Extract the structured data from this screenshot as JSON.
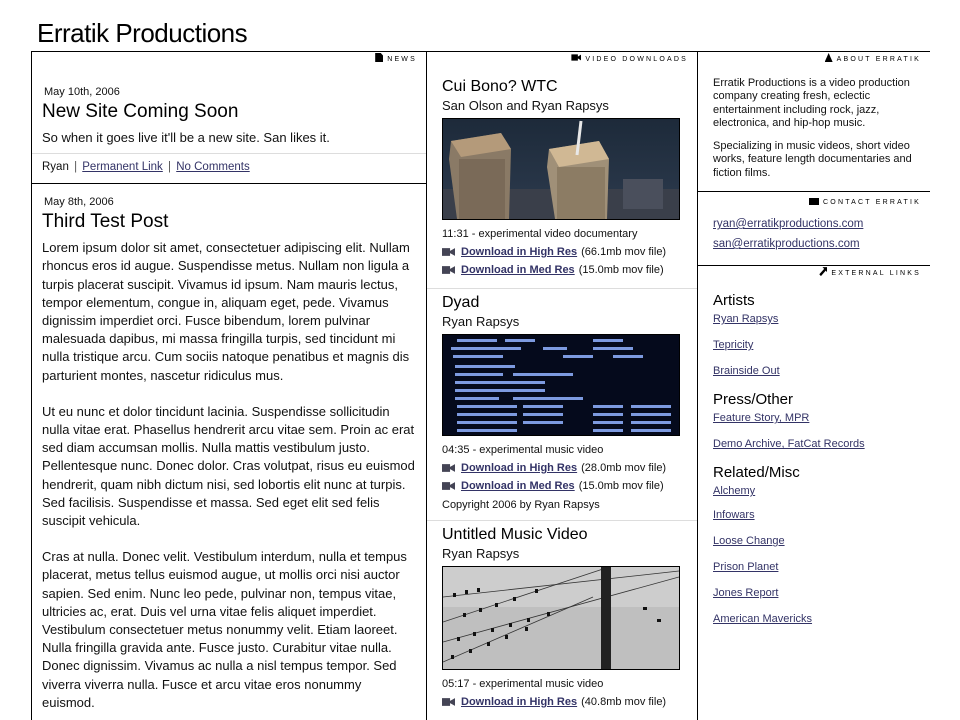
{
  "site": {
    "title": "Erratik Productions"
  },
  "news": {
    "heading": "News",
    "posts": [
      {
        "date": "May 10th, 2006",
        "title": "New Site Coming Soon",
        "body": [
          "So when it goes live it'll be a new site. San likes it."
        ],
        "author": "Ryan",
        "permalink_label": "Permanent Link",
        "comments_label": "No Comments",
        "separator": "|"
      },
      {
        "date": "May 8th, 2006",
        "title": "Third Test Post",
        "body": [
          "Lorem ipsum dolor sit amet, consectetuer adipiscing elit. Nullam rhoncus eros id augue. Suspendisse metus. Nullam non ligula a turpis placerat suscipit. Vivamus id ipsum. Nam mauris lectus, tempor elementum, congue in, aliquam eget, pede. Vivamus dignissim imperdiet orci. Fusce bibendum, lorem pulvinar malesuada dapibus, mi massa fringilla turpis, sed tincidunt mi nulla tristique arcu. Cum sociis natoque penatibus et magnis dis parturient montes, nascetur ridiculus mus.",
          "Ut eu nunc et dolor tincidunt lacinia. Suspendisse sollicitudin nulla vitae erat. Phasellus hendrerit arcu vitae sem. Proin ac erat sed diam accumsan mollis. Nulla mattis vestibulum justo. Pellentesque nunc. Donec dolor. Cras volutpat, risus eu euismod hendrerit, quam nibh dictum nisi, sed lobortis elit nunc at turpis. Sed facilisis. Suspendisse et massa. Sed eget elit sed felis suscipit vehicula.",
          "Cras at nulla. Donec velit. Vestibulum interdum, nulla et tempus placerat, metus tellus euismod augue, ut mollis orci nisi auctor sapien. Sed enim. Nunc leo pede, pulvinar non, tempus vitae, ultricies ac, erat. Duis vel urna vitae felis aliquet imperdiet. Vestibulum consectetuer metus nonummy velit. Etiam laoreet. Nulla fringilla gravida ante. Fusce justo. Curabitur vitae nulla. Donec dignissim. Vivamus ac nulla a nisl tempus tempor. Sed viverra viverra nulla. Fusce et arcu vitae eros nonummy euismod."
        ]
      }
    ]
  },
  "videos": {
    "heading": "Video Downloads",
    "items": [
      {
        "title": "Cui Bono? WTC",
        "artist": "San Olson and Ryan Rapsys",
        "thumb": "wtc-aerial",
        "desc": "11:31 - experimental video documentary",
        "downloads": [
          {
            "label": "Download in High Res",
            "size": "(66.1mb mov file)"
          },
          {
            "label": "Download in Med Res",
            "size": "(15.0mb mov file)"
          }
        ]
      },
      {
        "title": "Dyad",
        "artist": "Ryan Rapsys",
        "thumb": "terminal-screen",
        "desc": "04:35 - experimental music video",
        "downloads": [
          {
            "label": "Download in High Res",
            "size": "(28.0mb mov file)"
          },
          {
            "label": "Download in Med Res",
            "size": "(15.0mb mov file)"
          }
        ],
        "copyright": "Copyright 2006 by Ryan Rapsys"
      },
      {
        "title": "Untitled Music Video",
        "artist": "Ryan Rapsys",
        "thumb": "birds-wires",
        "desc": "05:17 - experimental music video",
        "downloads": [
          {
            "label": "Download in High Res",
            "size": "(40.8mb mov file)"
          }
        ]
      }
    ]
  },
  "about": {
    "heading": "About Erratik",
    "paragraphs": [
      "Erratik Productions is a video production company creating fresh, eclectic entertainment including rock, jazz, electronica, and hip-hop music.",
      "Specializing in music videos, short video works, feature length documentaries and fiction films."
    ]
  },
  "contact": {
    "heading": "Contact Erratik",
    "emails": [
      "ryan@erratikproductions.com",
      "san@erratikproductions.com"
    ]
  },
  "external": {
    "heading": "External Links",
    "groups": [
      {
        "title": "Artists",
        "links": [
          "Ryan Rapsys",
          "Tepricity",
          "Brainside Out"
        ]
      },
      {
        "title": "Press/Other",
        "links": [
          "Feature Story, MPR",
          "Demo Archive, FatCat Records"
        ]
      },
      {
        "title": "Related/Misc",
        "links": [
          "Alchemy",
          "Infowars",
          "Loose Change",
          "Prison Planet",
          "Jones Report",
          "American Mavericks"
        ]
      }
    ]
  },
  "colors": {
    "link": "#333366",
    "rule": "#000000",
    "soft_rule": "#dddddd"
  }
}
